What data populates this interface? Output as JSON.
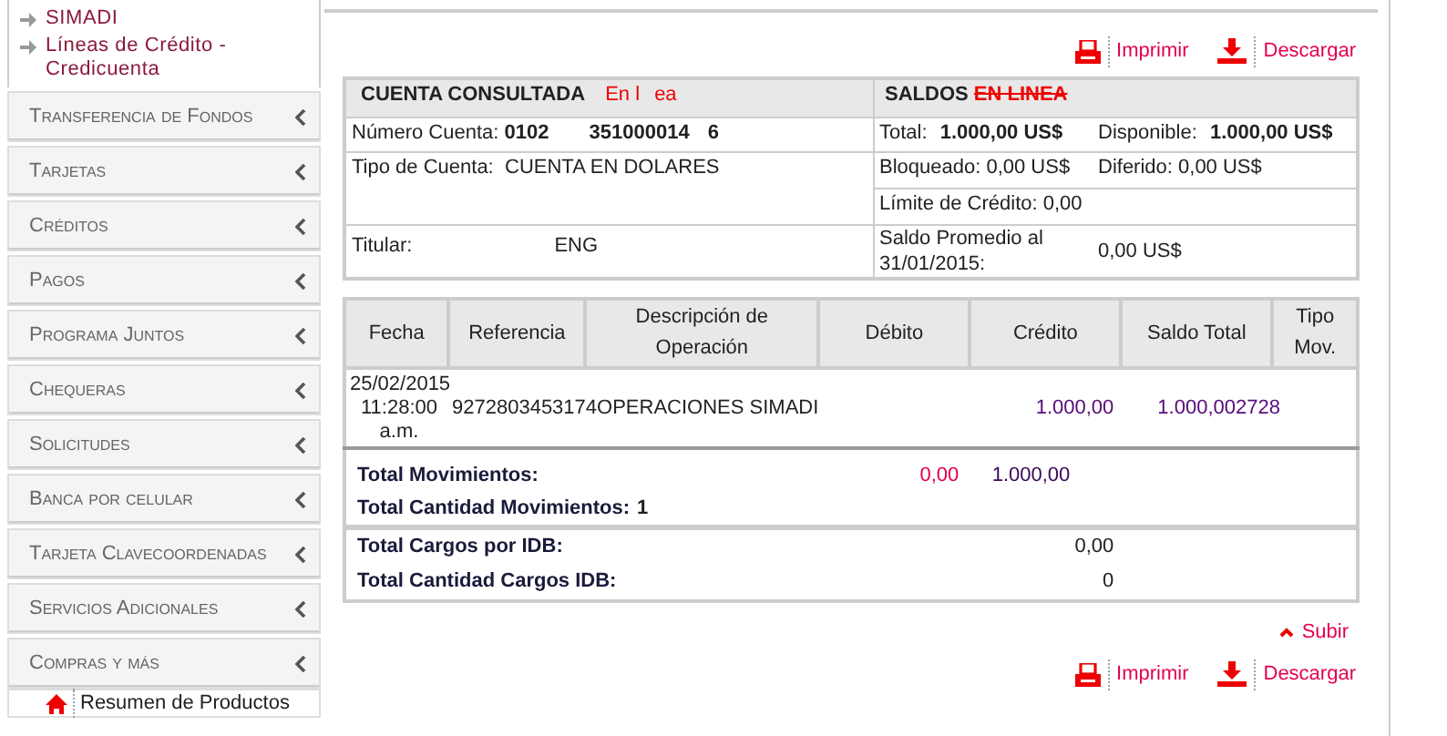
{
  "sidebar": {
    "links": [
      "SIMADI",
      "Líneas de Crédito - Credicuenta"
    ],
    "menu": [
      "Transferencia de Fondos",
      "Tarjetas",
      "Créditos",
      "Pagos",
      "Programa Juntos",
      "Chequeras",
      "Solicitudes",
      "Banca por celular",
      "Tarjeta Clavecoordenadas",
      "Servicios Adicionales",
      "Compras y más"
    ],
    "bottom_link": "Resumen de Productos"
  },
  "actions": {
    "print": "Imprimir",
    "download": "Descargar"
  },
  "account": {
    "title": "CUENTA CONSULTADA",
    "status": "En l",
    "status_end": "ea",
    "number_label": "Número Cuenta:",
    "number_parts": [
      "0102",
      "351000014",
      "6"
    ],
    "type_label": "Tipo de Cuenta:",
    "type_value": "CUENTA EN DOLARES",
    "holder_label": "Titular:",
    "holder_value": "ENG"
  },
  "balances": {
    "title": "SALDOS",
    "title_struck": "EN LINEA",
    "total_label": "Total:",
    "total_value": "1.000,00 US$",
    "available_label": "Disponible:",
    "available_value": "1.000,00 US$",
    "blocked": "Bloqueado: 0,00 US$",
    "deferred": "Diferido: 0,00 US$",
    "limit": "Límite de Crédito: 0,00",
    "average_label": "Saldo Promedio al 31/01/2015:",
    "average_value": "0,00 US$"
  },
  "movements": {
    "columns": [
      "Fecha",
      "Referencia",
      "Descripción de Operación",
      "Débito",
      "Crédito",
      "Saldo Total",
      "Tipo Mov."
    ],
    "rows": [
      {
        "date": "25/02/2015 11:28:00 a.m.",
        "reference": "9272803453174",
        "description": "OPERACIONES SIMADI",
        "debit": "",
        "credit": "1.000,00",
        "balance": "1.000,002728",
        "type": ""
      }
    ],
    "totals": [
      {
        "label": "Total Movimientos:",
        "debit": "0,00",
        "credit": "1.000,00"
      },
      {
        "label": "Total Cantidad Movimientos:",
        "value": "1"
      }
    ],
    "idb": [
      {
        "label": "Total Cargos por IDB:",
        "value": "0,00"
      },
      {
        "label": "Total Cantidad Cargos IDB:",
        "value": "0"
      }
    ]
  },
  "footer": {
    "up": "Subir",
    "print": "Imprimir",
    "download": "Descargar"
  }
}
